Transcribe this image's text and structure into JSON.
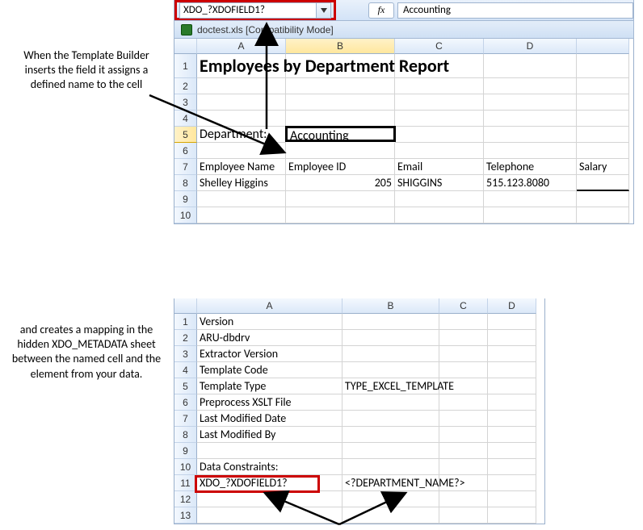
{
  "annotations": {
    "top": "When the Template Builder inserts the field it assigns a defined name to the cell",
    "mid": "and creates a mapping in the hidden XDO_METADATA sheet between the named cell and the element from your data."
  },
  "topExcel": {
    "nameBox": "XDO_?XDOFIELD1?",
    "fxLabel": "fx",
    "fxValue": "Accounting",
    "docTitle": "doctest.xls  [Compatibility Mode]",
    "cols": [
      "A",
      "B",
      "C",
      "D",
      ""
    ],
    "rows": [
      "1",
      "2",
      "3",
      "4",
      "5",
      "6",
      "7",
      "8",
      "9",
      "10"
    ],
    "title": "Employees by Department Report",
    "a5": "Department:",
    "b5": "Accounting",
    "hdr": {
      "a7": "Employee Name",
      "b7": "Employee ID",
      "c7": "Email",
      "d7": "Telephone",
      "e7": "Salary"
    },
    "row8": {
      "a": "Shelley Higgins",
      "b": "205",
      "c": "SHIGGINS",
      "d": "515.123.8080"
    }
  },
  "botExcel": {
    "cols": [
      "A",
      "B",
      "C",
      "D"
    ],
    "rows": [
      "1",
      "2",
      "3",
      "4",
      "5",
      "6",
      "7",
      "8",
      "9",
      "10",
      "11",
      "12",
      "13"
    ],
    "cells": {
      "a1": "Version",
      "a2": "ARU-dbdrv",
      "a3": "Extractor Version",
      "a4": "Template Code",
      "a5": "Template Type",
      "b5": "TYPE_EXCEL_TEMPLATE",
      "a6": "Preprocess XSLT File",
      "a7": "Last Modified Date",
      "a8": "Last Modified By",
      "a10": "Data Constraints:",
      "a11": "XDO_?XDOFIELD1?",
      "b11": "<?DEPARTMENT_NAME?>"
    }
  }
}
